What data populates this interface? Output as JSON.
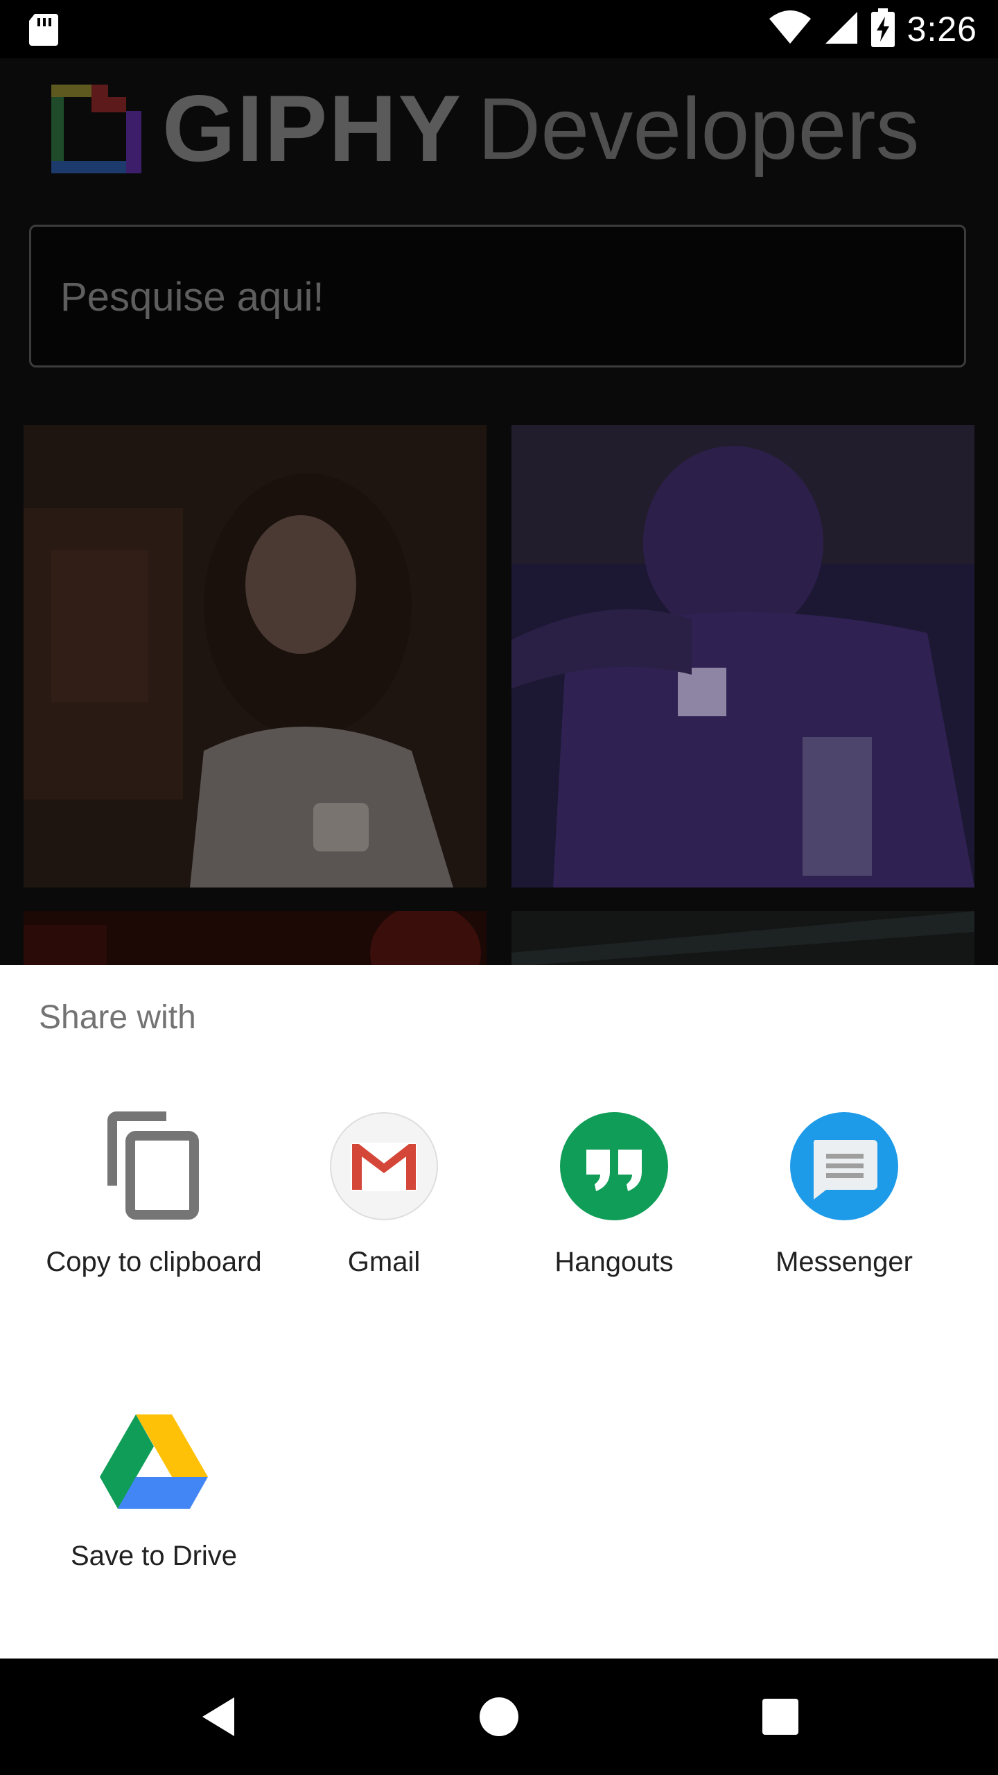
{
  "status_bar": {
    "time": "3:26",
    "icons": [
      "sd-card-icon",
      "wifi-icon",
      "signal-icon",
      "battery-charging-icon"
    ]
  },
  "app": {
    "logo_text_giphy": "GIPHY",
    "logo_text_developers": "Developers",
    "search": {
      "placeholder": "Pesquise aqui!",
      "value": ""
    }
  },
  "share_sheet": {
    "title": "Share with",
    "targets": [
      {
        "label": "Copy to clipboard",
        "icon": "copy-icon"
      },
      {
        "label": "Gmail",
        "icon": "gmail-icon",
        "color": "#D44638"
      },
      {
        "label": "Hangouts",
        "icon": "hangouts-icon",
        "color": "#0F9D58"
      },
      {
        "label": "Messenger",
        "icon": "messenger-icon",
        "color": "#1E9BE8"
      },
      {
        "label": "Save to Drive",
        "icon": "drive-icon"
      }
    ]
  },
  "nav_bar": {
    "buttons": [
      "back-icon",
      "home-icon",
      "recents-icon"
    ]
  },
  "colors": {
    "scrim_background": "#0a0a0a",
    "sheet_background": "#ffffff",
    "sheet_title": "#737373",
    "label_text": "#212121"
  }
}
